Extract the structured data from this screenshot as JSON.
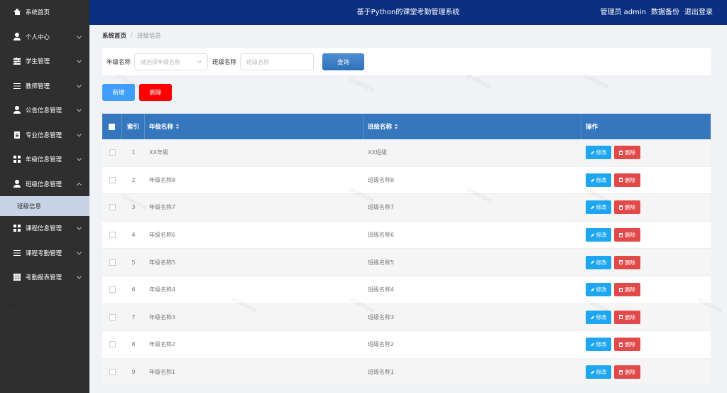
{
  "sidebar": {
    "items": [
      {
        "label": "系统首页",
        "icon": "home-icon",
        "has_chevron": false
      },
      {
        "label": "个人中心",
        "icon": "user-icon",
        "has_chevron": true
      },
      {
        "label": "学生管理",
        "icon": "sliders-icon",
        "has_chevron": true
      },
      {
        "label": "教师管理",
        "icon": "list-icon",
        "has_chevron": true
      },
      {
        "label": "公告信息管理",
        "icon": "user-icon",
        "has_chevron": true
      },
      {
        "label": "专业信息管理",
        "icon": "clipboard-icon",
        "has_chevron": true
      },
      {
        "label": "年级信息管理",
        "icon": "grid-icon",
        "has_chevron": true
      },
      {
        "label": "班级信息管理",
        "icon": "user-icon",
        "has_chevron": true,
        "expanded": true
      },
      {
        "label": "课程信息管理",
        "icon": "grid-icon",
        "has_chevron": true
      },
      {
        "label": "课程考勤管理",
        "icon": "list-icon",
        "has_chevron": true
      },
      {
        "label": "考勤报表管理",
        "icon": "grid9-icon",
        "has_chevron": true
      }
    ],
    "submenu": {
      "label": "班级信息"
    }
  },
  "header": {
    "title": "基于Python的课堂考勤管理系统",
    "user": "管理员 admin",
    "backup": "数据备份",
    "logout": "退出登录"
  },
  "breadcrumb": {
    "home": "系统首页",
    "current": "班级信息"
  },
  "search": {
    "grade_label": "年级名称",
    "grade_placeholder": "请选择年级名称",
    "class_label": "班级名称",
    "class_placeholder": "班级名称",
    "query_button": "查询"
  },
  "actions": {
    "add": "新增",
    "delete": "删除"
  },
  "table": {
    "headers": {
      "index": "索引",
      "grade": "年级名称",
      "class": "班级名称",
      "ops": "操作"
    },
    "edit_label": "修改",
    "delete_label": "删除",
    "rows": [
      {
        "index": "1",
        "grade": "XX年级",
        "class": "XX班级"
      },
      {
        "index": "2",
        "grade": "年级名称8",
        "class": "班级名称8"
      },
      {
        "index": "3",
        "grade": "年级名称7",
        "class": "班级名称7"
      },
      {
        "index": "4",
        "grade": "年级名称6",
        "class": "班级名称6"
      },
      {
        "index": "5",
        "grade": "年级名称5",
        "class": "班级名称5"
      },
      {
        "index": "6",
        "grade": "年级名称4",
        "class": "班级名称4"
      },
      {
        "index": "7",
        "grade": "年级名称3",
        "class": "班级名称3"
      },
      {
        "index": "8",
        "grade": "年级名称2",
        "class": "班级名称2"
      },
      {
        "index": "9",
        "grade": "年级名称1",
        "class": "班级名称1"
      }
    ]
  },
  "colors": {
    "sidebar_bg": "#2f2f2f",
    "header_bg": "#0b2f80",
    "table_header": "#3576bd",
    "add_button": "#409eff",
    "delete_button": "#ff0000"
  }
}
